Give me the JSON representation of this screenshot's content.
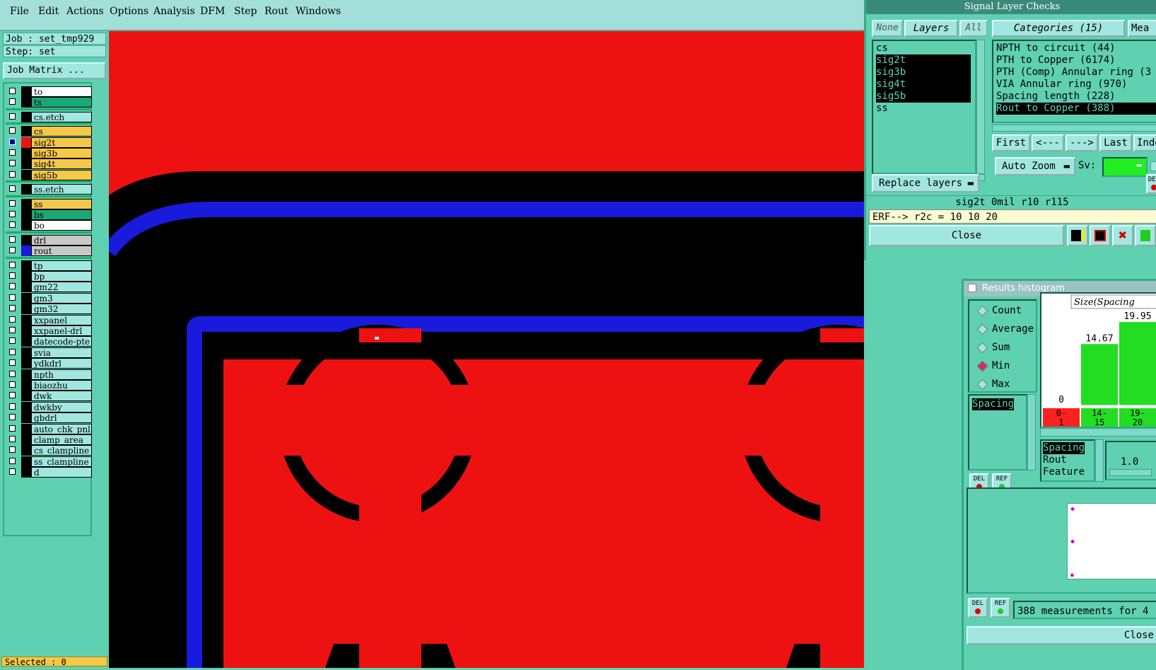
{
  "menubar": {
    "items": [
      "File",
      "Edit",
      "Actions",
      "Options",
      "Analysis",
      "DFM",
      "Step",
      "Rout",
      "Windows"
    ]
  },
  "job": {
    "job_label": "Job : set_tmp929",
    "step_label": "Step: set",
    "matrix_button": "Job Matrix ..."
  },
  "layers": [
    {
      "name": "to",
      "color": "#ffffff",
      "checked": false
    },
    {
      "name": "ts",
      "color": "#1aa878",
      "checked": false
    },
    {
      "name": "cs.etch",
      "color": "#a2e6e0",
      "checked": false
    },
    {
      "name": "cs",
      "color": "#f5c84a",
      "checked": false
    },
    {
      "name": "sig2t",
      "color": "#f5c84a",
      "checked": true,
      "swatch": "#ee1111"
    },
    {
      "name": "sig3b",
      "color": "#f5c84a",
      "checked": false
    },
    {
      "name": "sig4t",
      "color": "#f5c84a",
      "checked": false
    },
    {
      "name": "sig5b",
      "color": "#f5c84a",
      "checked": false
    },
    {
      "name": "ss.etch",
      "color": "#a2e6e0",
      "checked": false
    },
    {
      "name": "ss",
      "color": "#f5c84a",
      "checked": false
    },
    {
      "name": "bs",
      "color": "#1aa878",
      "checked": false
    },
    {
      "name": "bo",
      "color": "#ffffff",
      "checked": false
    },
    {
      "name": "drl",
      "color": "#c8c8c8",
      "checked": false
    },
    {
      "name": "rout",
      "color": "#c8c8c8",
      "checked": false,
      "swatch": "#1a1add"
    },
    {
      "name": "tp",
      "color": "#a2e6e0",
      "checked": false
    },
    {
      "name": "bp",
      "color": "#a2e6e0",
      "checked": false
    },
    {
      "name": "gm22",
      "color": "#a2e6e0",
      "checked": false
    },
    {
      "name": "gm3",
      "color": "#a2e6e0",
      "checked": false
    },
    {
      "name": "gm32",
      "color": "#a2e6e0",
      "checked": false
    },
    {
      "name": "xxpanel",
      "color": "#a2e6e0",
      "checked": false
    },
    {
      "name": "xxpanel-drl",
      "color": "#a2e6e0",
      "checked": false
    },
    {
      "name": "datecode-pte",
      "color": "#a2e6e0",
      "checked": false
    },
    {
      "name": "svia",
      "color": "#a2e6e0",
      "checked": false
    },
    {
      "name": "ydkdrl",
      "color": "#a2e6e0",
      "checked": false
    },
    {
      "name": "npth",
      "color": "#a2e6e0",
      "checked": false
    },
    {
      "name": "biaozhu",
      "color": "#a2e6e0",
      "checked": false
    },
    {
      "name": "dwk",
      "color": "#a2e6e0",
      "checked": false
    },
    {
      "name": "dwkby",
      "color": "#a2e6e0",
      "checked": false
    },
    {
      "name": "gbdrl",
      "color": "#a2e6e0",
      "checked": false
    },
    {
      "name": "auto_chk_pnl",
      "color": "#a2e6e0",
      "checked": false
    },
    {
      "name": "clamp_area",
      "color": "#a2e6e0",
      "checked": false
    },
    {
      "name": "cs_clampline",
      "color": "#a2e6e0",
      "checked": false
    },
    {
      "name": "ss_clampline",
      "color": "#a2e6e0",
      "checked": false
    },
    {
      "name": "d",
      "color": "#a2e6e0",
      "checked": false
    }
  ],
  "status": {
    "selected": "Selected : 0"
  },
  "slc": {
    "title": "Signal Layer Checks",
    "btn_none": "None",
    "btn_layers": "Layers",
    "btn_all": "All",
    "layer_list": [
      {
        "name": "cs",
        "selected": false
      },
      {
        "name": "sig2t",
        "selected": true
      },
      {
        "name": "sig3b",
        "selected": true
      },
      {
        "name": "sig4t",
        "selected": true
      },
      {
        "name": "sig5b",
        "selected": true
      },
      {
        "name": "ss",
        "selected": false
      }
    ],
    "categories_header": "Categories (15)",
    "meas_header": "Mea",
    "categories": [
      {
        "text": "NPTH to circuit (44)",
        "selected": false
      },
      {
        "text": "PTH to Copper (6174)",
        "selected": false
      },
      {
        "text": "PTH (Comp) Annular ring (3",
        "selected": false
      },
      {
        "text": "VIA Annular ring (970)",
        "selected": false
      },
      {
        "text": "Spacing length (228)",
        "selected": false
      },
      {
        "text": "Rout to Copper (388)",
        "selected": true
      }
    ],
    "nav": {
      "first": "First",
      "prev": "<---",
      "next": "--->",
      "last": "Last",
      "index": "Inde"
    },
    "auto_zoom": "Auto Zoom",
    "sv_label": "Sv:",
    "replace_layers": "Replace layers",
    "info_line": "sig2t 0mil   r10   r115",
    "erf_line": "ERF--> r2c = 10 10 20",
    "close": "Close",
    "del_label": "DEL"
  },
  "hist": {
    "title": "Results histogram",
    "radios": [
      {
        "label": "Count",
        "on": false
      },
      {
        "label": "Average",
        "on": false
      },
      {
        "label": "Sum",
        "on": false
      },
      {
        "label": "Min",
        "on": true
      },
      {
        "label": "Max",
        "on": false
      }
    ],
    "size_label": "Size(Spacing",
    "list1": [
      "Spacing"
    ],
    "list2": [
      "Spacing",
      "Rout",
      "Feature"
    ],
    "scale_value": "1.0",
    "chart_data": {
      "type": "bar",
      "categories": [
        "0-1",
        "14-15",
        "19-20"
      ],
      "values": [
        0,
        14.67,
        19.95
      ],
      "value_labels": [
        "0",
        "14.67",
        "19.95"
      ],
      "bar_colors": [
        "#ee2222",
        "#22dd22",
        "#22dd22"
      ],
      "bin_label_colors": [
        "#ff2020",
        "#22dd22",
        "#22dd22"
      ],
      "bin_labels_top": [
        "0-",
        "14-",
        "19-"
      ],
      "bin_labels_bottom": [
        "1",
        "15",
        "20"
      ]
    },
    "measurements": "388 measurements for 4",
    "del": "DEL",
    "ref": "REF",
    "close": "Close"
  }
}
